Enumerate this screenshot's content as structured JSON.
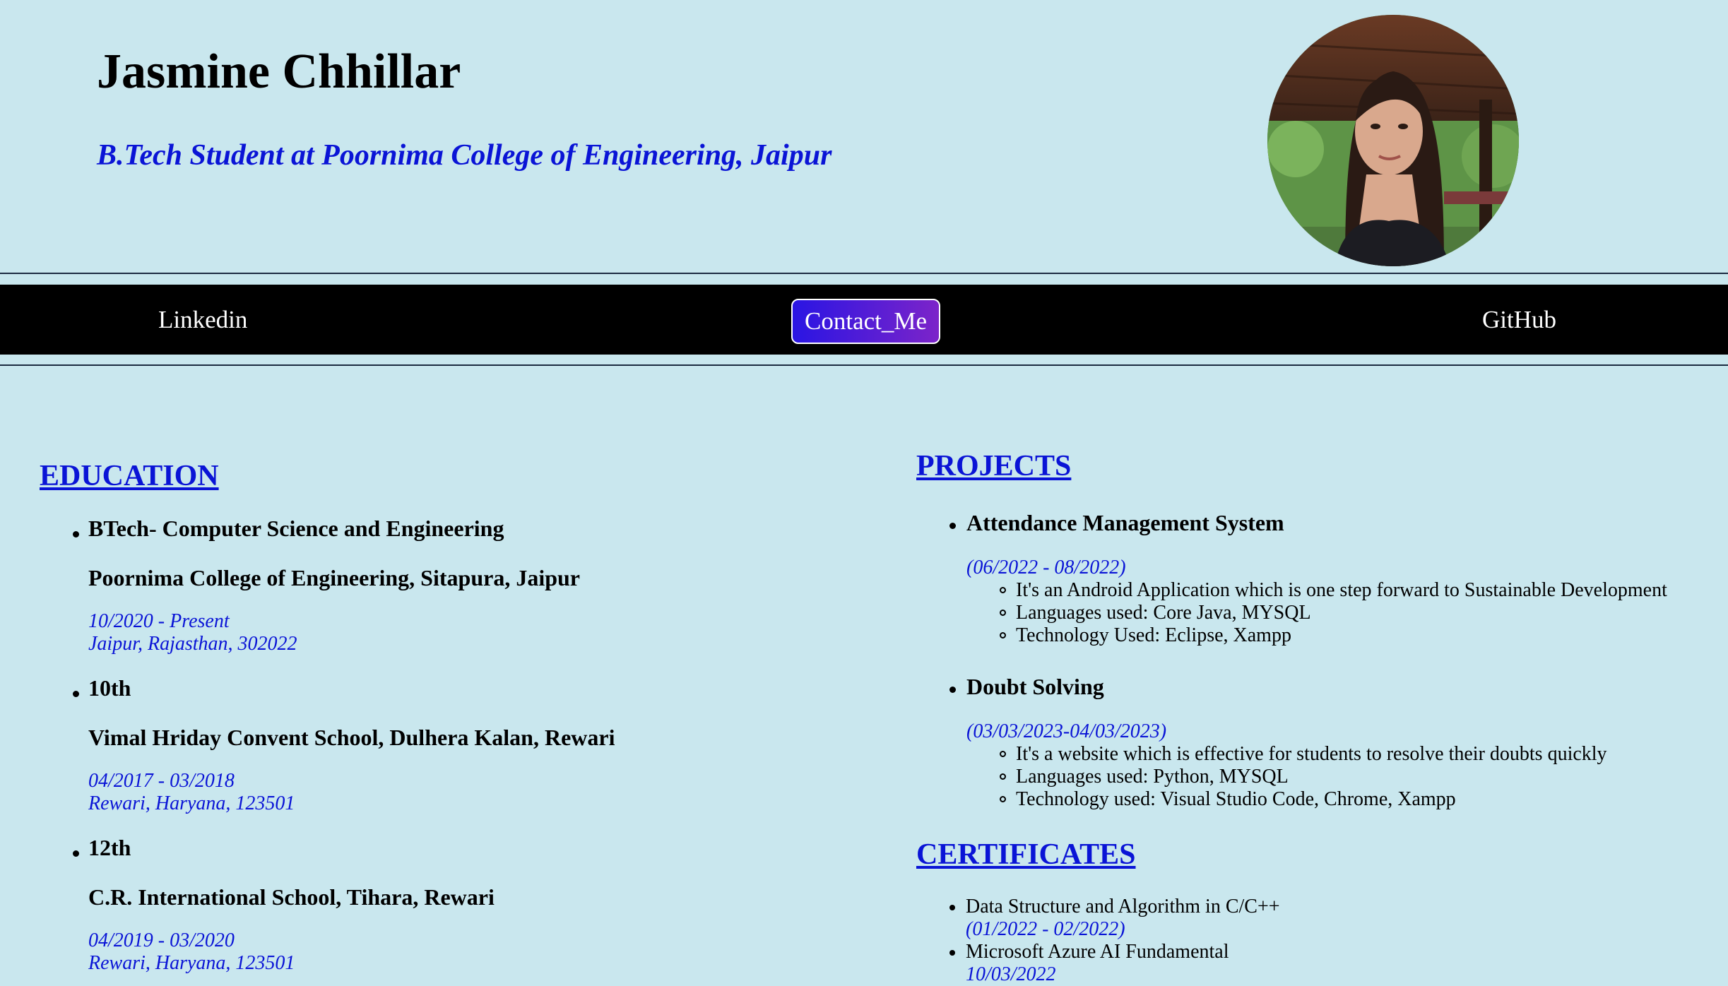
{
  "header": {
    "name": "Jasmine Chhillar",
    "tagline": "B.Tech Student at Poornima College of Engineering, Jaipur",
    "avatar_alt": "profile-photo"
  },
  "nav": {
    "linkedin": "Linkedin",
    "contact": "Contact_Me",
    "github": "GitHub"
  },
  "education": {
    "title": "EDUCATION",
    "items": [
      {
        "degree": "BTech- Computer Science and Engineering",
        "school": "Poornima College of Engineering, Sitapura, Jaipur",
        "date": "10/2020 - Present",
        "location": "Jaipur, Rajasthan, 302022"
      },
      {
        "degree": "10th",
        "school": "Vimal Hriday Convent School, Dulhera Kalan, Rewari",
        "date": "04/2017 - 03/2018",
        "location": "Rewari, Haryana, 123501"
      },
      {
        "degree": "12th",
        "school": "C.R. International School, Tihara, Rewari",
        "date": "04/2019 - 03/2020",
        "location": "Rewari, Haryana, 123501"
      }
    ]
  },
  "projects": {
    "title": "PROJECTS",
    "items": [
      {
        "name": "Attendance Management System",
        "date": "(06/2022 - 08/2022)",
        "points": [
          "It's an Android Application which is one step forward to Sustainable Development",
          "Languages used: Core Java, MYSQL",
          "Technology Used: Eclipse, Xampp"
        ]
      },
      {
        "name": "Doubt Solving",
        "date": "(03/03/2023-04/03/2023)",
        "points": [
          "It's a website which is effective for students to resolve their doubts quickly",
          "Languages used: Python, MYSQL",
          "Technology used: Visual Studio Code, Chrome, Xampp"
        ]
      }
    ]
  },
  "certificates": {
    "title": "CERTIFICATES",
    "items": [
      {
        "name": "Data Structure and Algorithm in C/C++",
        "date": "(01/2022 - 02/2022)"
      },
      {
        "name": "Microsoft Azure AI Fundamental",
        "date": "10/03/2022"
      }
    ]
  },
  "colors": {
    "background": "#c9e7ee",
    "accent": "#0a14d6",
    "nav": "#000000"
  }
}
